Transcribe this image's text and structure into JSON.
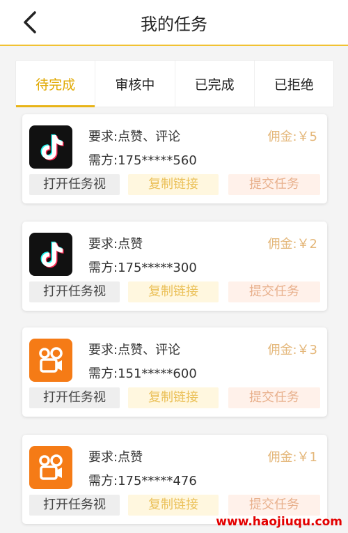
{
  "header": {
    "title": "我的任务"
  },
  "tabs": [
    {
      "label": "待完成",
      "active": true
    },
    {
      "label": "审核中",
      "active": false
    },
    {
      "label": "已完成",
      "active": false
    },
    {
      "label": "已拒绝",
      "active": false
    }
  ],
  "tasks": [
    {
      "app_icon": "tiktok-icon",
      "requirement": "要求:点赞、评论",
      "requester": "需方:175*****560",
      "commission": "佣金:￥5",
      "open_label": "打开任务视",
      "copy_label": "复制链接",
      "submit_label": "提交任务"
    },
    {
      "app_icon": "tiktok-icon",
      "requirement": "要求:点赞",
      "requester": "需方:175*****300",
      "commission": "佣金:￥2",
      "open_label": "打开任务视",
      "copy_label": "复制链接",
      "submit_label": "提交任务"
    },
    {
      "app_icon": "kuaishou-icon",
      "requirement": "要求:点赞、评论",
      "requester": "需方:151*****600",
      "commission": "佣金:￥3",
      "open_label": "打开任务视",
      "copy_label": "复制链接",
      "submit_label": "提交任务"
    },
    {
      "app_icon": "kuaishou-icon",
      "requirement": "要求:点赞",
      "requester": "需方:175*****476",
      "commission": "佣金:￥1",
      "open_label": "打开任务视",
      "copy_label": "复制链接",
      "submit_label": "提交任务"
    }
  ],
  "watermark": "www.haojiuqu.com",
  "colors": {
    "accent": "#e8b418",
    "commission": "#e4b77a",
    "tiktok_bg": "#111111",
    "kuaishou_bg": "#f57b16"
  }
}
